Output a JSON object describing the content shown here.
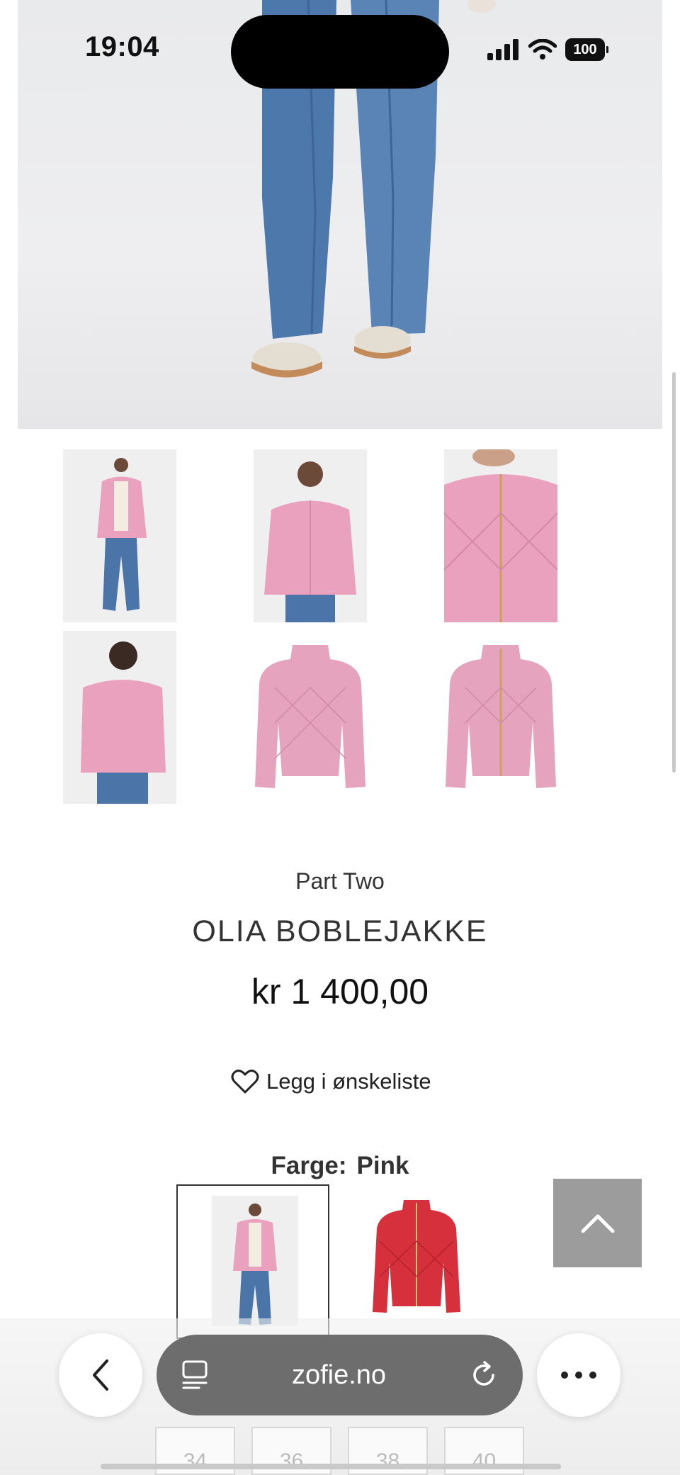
{
  "status_bar": {
    "time": "19:04",
    "battery": "100"
  },
  "product": {
    "brand": "Part Two",
    "name": "OLIA BOBLEJAKKE",
    "price": "kr 1 400,00",
    "wishlist_label": "Legg i ønskeliste",
    "color_label": "Farge:",
    "color_value": "Pink",
    "sizes": [
      "34",
      "36",
      "38",
      "40"
    ]
  },
  "browser": {
    "url": "zofie.no"
  },
  "colors": {
    "jacket_pink": "#e9a1bd",
    "jacket_red": "#d5303b",
    "denim": "#4b74a8",
    "to_top_button": "#9c9c9c",
    "url_bar": "#6d6d6d"
  },
  "icons": {
    "back": "chevron-left-icon",
    "tabs": "tab-overview-icon",
    "reload": "reload-icon",
    "more": "more-dots-icon",
    "wishlist": "heart-outline-icon",
    "to_top": "chevron-up-icon"
  }
}
